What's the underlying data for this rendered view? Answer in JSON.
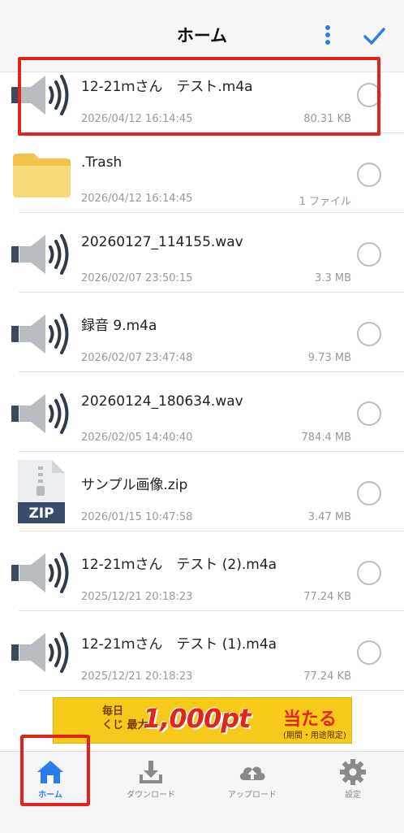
{
  "header": {
    "title": "ホーム"
  },
  "files": [
    {
      "name": "12-21ｍさん　テスト.m4a",
      "date": "2026/04/12 16:14:45",
      "size": "80.31 KB",
      "icon": "speaker-icon"
    },
    {
      "name": ".Trash",
      "date": "2026/04/12 16:14:45",
      "size": "1 ファイル",
      "icon": "folder-icon"
    },
    {
      "name": "20260127_114155.wav",
      "date": "2026/02/07 23:50:15",
      "size": "3.3 MB",
      "icon": "speaker-icon"
    },
    {
      "name": "録音 9.m4a",
      "date": "2026/02/07 23:47:48",
      "size": "9.73 MB",
      "icon": "speaker-icon"
    },
    {
      "name": "20260124_180634.wav",
      "date": "2026/02/05 14:40:40",
      "size": "784.4 MB",
      "icon": "speaker-icon"
    },
    {
      "name": "サンプル画像.zip",
      "date": "2026/01/15 10:47:58",
      "size": "3.47 MB",
      "icon": "zip-icon"
    },
    {
      "name": "12-21ｍさん　テスト (2).m4a",
      "date": "2025/12/21 20:18:23",
      "size": "77.24 KB",
      "icon": "speaker-icon"
    },
    {
      "name": "12-21ｍさん　テスト (1).m4a",
      "date": "2025/12/21 20:18:23",
      "size": "77.24 KB",
      "icon": "speaker-icon"
    }
  ],
  "zip_badge": "ZIP",
  "ad": {
    "left": "毎日\nくじ 最大",
    "main": "1,000pt",
    "right": "当たる",
    "note": "(期間・用途限定)"
  },
  "tabs": [
    {
      "label": "ホーム",
      "icon": "home-icon",
      "active": true
    },
    {
      "label": "ダウンロード",
      "icon": "download-icon",
      "active": false
    },
    {
      "label": "アップロード",
      "icon": "cloud-upload-icon",
      "active": false
    },
    {
      "label": "設定",
      "icon": "gear-icon",
      "active": false
    }
  ],
  "colors": {
    "accent": "#2b7de9",
    "highlight": "#e2231a",
    "folder": "#f6d36b",
    "icon_dark": "#2f3a4a"
  }
}
